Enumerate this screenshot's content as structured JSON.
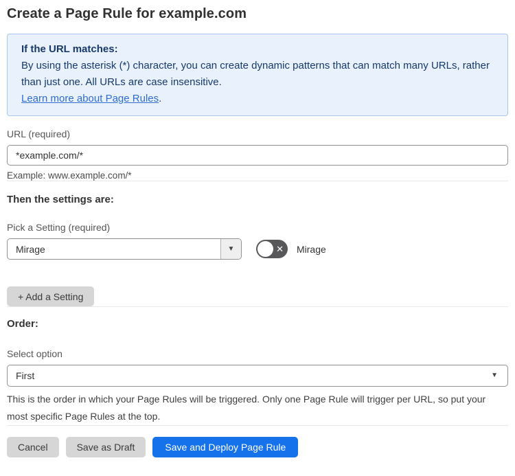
{
  "page": {
    "title": "Create a Page Rule for example.com"
  },
  "info_box": {
    "heading": "If the URL matches:",
    "body": "By using the asterisk (*) character, you can create dynamic patterns that can match many URLs, rather than just one. All URLs are case insensitive.",
    "link_label": "Learn more about Page Rules",
    "link_suffix": "."
  },
  "url_field": {
    "label": "URL (required)",
    "value": "*example.com/*",
    "hint": "Example: www.example.com/*"
  },
  "settings_section": {
    "heading": "Then the settings are:",
    "picker_label": "Pick a Setting (required)",
    "picker_value": "Mirage",
    "picker_arrow": "▼",
    "toggle_state": "off",
    "toggle_glyph": "✕",
    "toggle_label": "Mirage",
    "add_button_label": "+ Add a Setting"
  },
  "order_section": {
    "heading": "Order:",
    "select_label": "Select option",
    "select_value": "First",
    "select_arrow": "▼",
    "description": "This is the order in which your Page Rules will be triggered. Only one Page Rule will trigger per URL, so put your most specific Page Rules at the top."
  },
  "footer": {
    "cancel_label": "Cancel",
    "save_draft_label": "Save as Draft",
    "save_deploy_label": "Save and Deploy Page Rule"
  },
  "colors": {
    "accent_blue": "#1672eb",
    "info_bg": "#e9f2fc",
    "info_border": "#a9c9ec",
    "info_text": "#17396b",
    "link_blue": "#2f6bd2",
    "toggle_off_bg": "#58585a"
  }
}
